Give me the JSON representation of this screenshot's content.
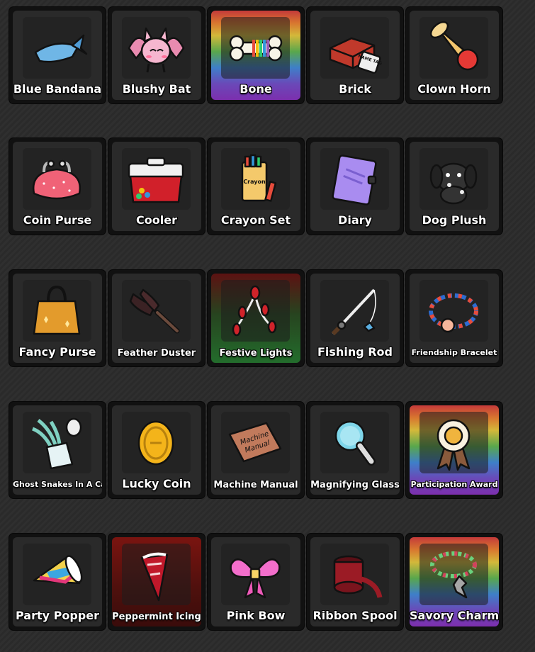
{
  "inventory": {
    "items": [
      {
        "name": "Blue Bandana",
        "icon": "bandana-icon",
        "background": "dark"
      },
      {
        "name": "Blushy Bat",
        "icon": "bat-icon",
        "background": "dark"
      },
      {
        "name": "Bone",
        "icon": "bone-icon",
        "background": "rainbow"
      },
      {
        "name": "Brick",
        "icon": "brick-icon",
        "background": "dark"
      },
      {
        "name": "Clown Horn",
        "icon": "horn-icon",
        "background": "dark"
      },
      {
        "name": "Coin Purse",
        "icon": "coin-purse-icon",
        "background": "dark"
      },
      {
        "name": "Cooler",
        "icon": "cooler-icon",
        "background": "dark"
      },
      {
        "name": "Crayon Set",
        "icon": "crayon-set-icon",
        "background": "dark"
      },
      {
        "name": "Diary",
        "icon": "diary-icon",
        "background": "dark"
      },
      {
        "name": "Dog Plush",
        "icon": "dog-plush-icon",
        "background": "dark"
      },
      {
        "name": "Fancy Purse",
        "icon": "fancy-purse-icon",
        "background": "dark"
      },
      {
        "name": "Feather Duster",
        "icon": "feather-duster-icon",
        "background": "dark"
      },
      {
        "name": "Festive Lights",
        "icon": "festive-lights-icon",
        "background": "green"
      },
      {
        "name": "Fishing Rod",
        "icon": "fishing-rod-icon",
        "background": "dark"
      },
      {
        "name": "Friendship Bracelet",
        "icon": "bracelet-icon",
        "background": "dark"
      },
      {
        "name": "Ghost Snakes In A Can",
        "icon": "ghost-snakes-icon",
        "background": "dark"
      },
      {
        "name": "Lucky Coin",
        "icon": "lucky-coin-icon",
        "background": "dark"
      },
      {
        "name": "Machine Manual",
        "icon": "manual-icon",
        "background": "dark"
      },
      {
        "name": "Magnifying Glass",
        "icon": "magnifying-glass-icon",
        "background": "dark"
      },
      {
        "name": "Participation Award",
        "icon": "award-ribbon-icon",
        "background": "rainbow"
      },
      {
        "name": "Party Popper",
        "icon": "party-popper-icon",
        "background": "dark"
      },
      {
        "name": "Peppermint Icing",
        "icon": "icing-bag-icon",
        "background": "red"
      },
      {
        "name": "Pink Bow",
        "icon": "bow-icon",
        "background": "dark"
      },
      {
        "name": "Ribbon Spool",
        "icon": "ribbon-spool-icon",
        "background": "dark"
      },
      {
        "name": "Savory Charm",
        "icon": "charm-icon",
        "background": "rainbow"
      }
    ]
  },
  "icon_text": {
    "brick_tag": "NAME TAG",
    "crayon_box": "Crayon",
    "manual_cover": "Machine Manual"
  }
}
